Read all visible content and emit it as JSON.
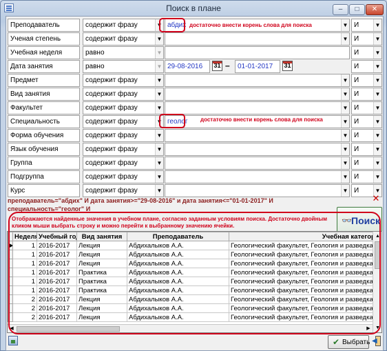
{
  "window": {
    "title": "Поиск в плане",
    "minimize": "–",
    "maximize": "□",
    "close": "✕"
  },
  "filters": [
    {
      "label": "Преподаватель",
      "op": "содержит фразу",
      "value": "абдих",
      "conj": "И"
    },
    {
      "label": "Ученая степень",
      "op": "содержит фразу",
      "value": "",
      "conj": "И"
    },
    {
      "label": "Учебная неделя",
      "op": "равно",
      "value": "",
      "conj": "И"
    },
    {
      "label": "Дата занятия",
      "op": "равно",
      "date_from": "29-08-2016",
      "date_to": "01-01-2017",
      "conj": "И"
    },
    {
      "label": "Предмет",
      "op": "содержит фразу",
      "value": "",
      "conj": "И"
    },
    {
      "label": "Вид занятия",
      "op": "содержит фразу",
      "value": "",
      "conj": "И"
    },
    {
      "label": "Факультет",
      "op": "содержит фразу",
      "value": "",
      "conj": "И"
    },
    {
      "label": "Специальность",
      "op": "содержит фразу",
      "value": "геолог",
      "conj": "И"
    },
    {
      "label": "Форма обучения",
      "op": "содержит фразу",
      "value": "",
      "conj": "И"
    },
    {
      "label": "Язык обучения",
      "op": "содержит фразу",
      "value": "",
      "conj": "И"
    },
    {
      "label": "Группа",
      "op": "содержит фразу",
      "value": "",
      "conj": "И"
    },
    {
      "label": "Подгруппа",
      "op": "содержит фразу",
      "value": "",
      "conj": "И"
    },
    {
      "label": "Курс",
      "op": "содержит фразу",
      "value": "",
      "conj": "И"
    }
  ],
  "hints": {
    "teacher": "достаточно внести корень слова для поиска",
    "specialty": "достаточно внести корень слова для поиска"
  },
  "query_text": "преподаватель=\"абдих\" И дата занятия>=\"29-08-2016\" и дата занятия<=\"01-01-2017\" И специальность=\"геолог\" И",
  "search_button": "Поиск",
  "grid_note": "Отображаются найденные значения в учебном плане, согласно заданным условиям поиска. Достаточно двойным кликом мыши выбрать строку и можно перейти к выбранному значению ячейки.",
  "columns": [
    "Неделя",
    "Учебный год",
    "Вид занятия",
    "Преподаватель",
    "Учебная категория"
  ],
  "rows": [
    [
      "1",
      "2016-2017",
      "Лекция",
      "Абдихалыков А.А.",
      "Геологический факультет, Геология и разведка м"
    ],
    [
      "1",
      "2016-2017",
      "Лекция",
      "Абдихалыков А.А.",
      "Геологический факультет, Геология и разведка м"
    ],
    [
      "1",
      "2016-2017",
      "Лекция",
      "Абдихалыков А.А.",
      "Геологический факультет, Геология и разведка м"
    ],
    [
      "1",
      "2016-2017",
      "Практика",
      "Абдихалыков А.А.",
      "Геологический факультет, Геология и разведка м"
    ],
    [
      "1",
      "2016-2017",
      "Практика",
      "Абдихалыков А.А.",
      "Геологический факультет, Геология и разведка м"
    ],
    [
      "1",
      "2016-2017",
      "Практика",
      "Абдихалыков А.А.",
      "Геологический факультет, Геология и разведка м"
    ],
    [
      "2",
      "2016-2017",
      "Лекция",
      "Абдихалыков А.А.",
      "Геологический факультет, Геология и разведка м"
    ],
    [
      "2",
      "2016-2017",
      "Лекция",
      "Абдихалыков А.А.",
      "Геологический факультет, Геология и разведка м"
    ],
    [
      "2",
      "2016-2017",
      "Лекция",
      "Абдихалыков А.А.",
      "Геологический факультет, Геология и разведка м"
    ]
  ],
  "select_button": "Выбрать",
  "colors": {
    "hint_red": "#d0021b",
    "query_text": "#8b1d1d",
    "value_blue": "#2236c4"
  }
}
